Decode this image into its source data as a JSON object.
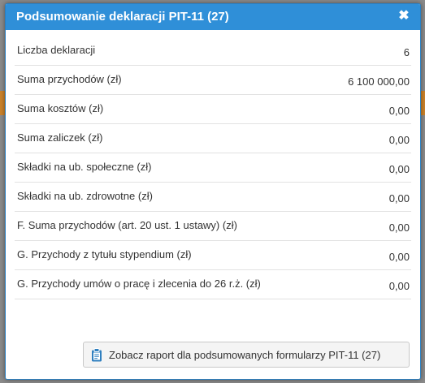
{
  "dialog": {
    "title": "Podsumowanie deklaracji PIT-11 (27)",
    "close_symbol": "✖"
  },
  "rows": [
    {
      "label": "Liczba deklaracji",
      "value": "6"
    },
    {
      "label": "Suma przychodów (zł)",
      "value": "6 100 000,00"
    },
    {
      "label": "Suma kosztów (zł)",
      "value": "0,00"
    },
    {
      "label": "Suma zaliczek (zł)",
      "value": "0,00"
    },
    {
      "label": "Składki na ub. społeczne  (zł)",
      "value": "0,00"
    },
    {
      "label": "Składki na ub. zdrowotne  (zł)",
      "value": "0,00"
    },
    {
      "label": "F. Suma przychodów (art. 20 ust. 1 ustawy) (zł)",
      "value": "0,00"
    },
    {
      "label": "G. Przychody z tytułu stypendium (zł)",
      "value": "0,00"
    },
    {
      "label": "G. Przychody umów o pracę i zlecenia do 26 r.ż. (zł)",
      "value": "0,00"
    }
  ],
  "report_button": {
    "label": "Zobacz raport dla podsumowanych formularzy PIT-11 (27)",
    "icon": "clipboard-icon"
  },
  "colors": {
    "titlebar": "#2f8fd8",
    "border": "#2a7fc1"
  }
}
